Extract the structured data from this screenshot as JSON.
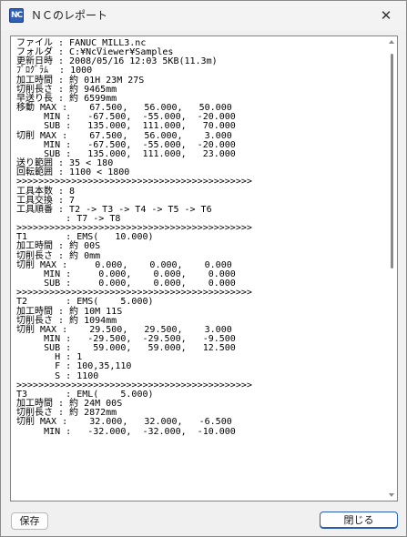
{
  "window": {
    "title": "ＮＣのレポート",
    "app_icon_text": "NC",
    "close_glyph": "✕"
  },
  "report": {
    "lines": [
      "ファイル : FANUC_MILL3.nc",
      "フォルダ : C:¥NcViewer¥Samples",
      "更新日時 : 2008/05/16 12:03 5KB(11.3m)",
      "ﾌﾟﾛｸﾞﾗﾑ  : 1000",
      "加工時間 : 約 01H 23M 27S",
      "切削長さ : 約 9465mm",
      "早送り長 : 約 6599mm",
      "移動 MAX :    67.500,   56.000,   50.000",
      "     MIN :   -67.500,  -55.000,  -20.000",
      "     SUB :   135.000,  111.000,   70.000",
      "切削 MAX :    67.500,   56.000,    3.000",
      "     MIN :   -67.500,  -55.000,  -20.000",
      "     SUB :   135.000,  111.000,   23.000",
      "送り範囲 : 35 < 180",
      "回転範囲 : 1100 < 1800",
      ">>>>>>>>>>>>>>>>>>>>>>>>>>>>>>>>>>>>>>>>>>>",
      "工具本数 : 8",
      "工具交換 : 7",
      "工具順番 : T2 -> T3 -> T4 -> T5 -> T6",
      "         : T7 -> T8",
      ">>>>>>>>>>>>>>>>>>>>>>>>>>>>>>>>>>>>>>>>>>>",
      "T1       : EMS(   10.000)",
      "加工時間 : 約 00S",
      "切削長さ : 約 0mm",
      "切削 MAX :     0.000,    0.000,    0.000",
      "     MIN :     0.000,    0.000,    0.000",
      "     SUB :     0.000,    0.000,    0.000",
      ">>>>>>>>>>>>>>>>>>>>>>>>>>>>>>>>>>>>>>>>>>>",
      "T2       : EMS(    5.000)",
      "加工時間 : 約 10M 11S",
      "切削長さ : 約 1094mm",
      "切削 MAX :    29.500,   29.500,    3.000",
      "     MIN :   -29.500,  -29.500,   -9.500",
      "     SUB :    59.000,   59.000,   12.500",
      "       H : 1",
      "       F : 100,35,110",
      "       S : 1100",
      ">>>>>>>>>>>>>>>>>>>>>>>>>>>>>>>>>>>>>>>>>>>",
      "T3       : EML(    5.000)",
      "加工時間 : 約 24M 00S",
      "切削長さ : 約 2872mm",
      "切削 MAX :    32.000,   32.000,   -6.500",
      "     MIN :   -32.000,  -32.000,  -10.000"
    ]
  },
  "buttons": {
    "save_label": "保存",
    "close_label": "閉じる"
  }
}
